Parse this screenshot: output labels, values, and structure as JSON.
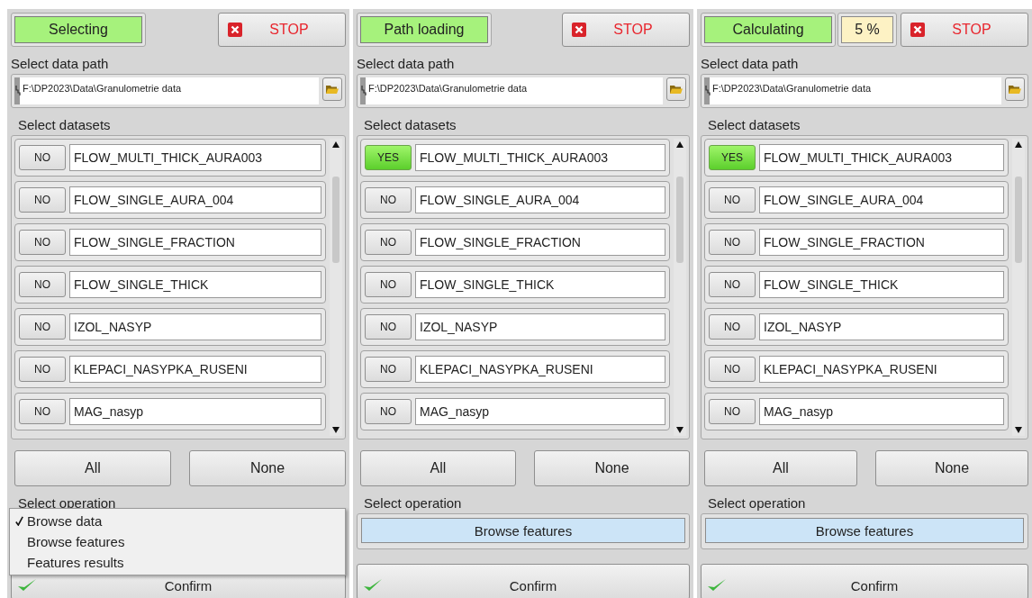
{
  "panels": [
    {
      "status": "Selecting",
      "stop": "STOP",
      "path_label": "Select data path",
      "path": "F:\\DP2023\\Data\\Granulometrie data",
      "datasets_label": "Select datasets",
      "datasets": [
        {
          "toggle": "NO",
          "selected": false,
          "name": "FLOW_MULTI_THICK_AURA003"
        },
        {
          "toggle": "NO",
          "selected": false,
          "name": "FLOW_SINGLE_AURA_004"
        },
        {
          "toggle": "NO",
          "selected": false,
          "name": "FLOW_SINGLE_FRACTION"
        },
        {
          "toggle": "NO",
          "selected": false,
          "name": "FLOW_SINGLE_THICK"
        },
        {
          "toggle": "NO",
          "selected": false,
          "name": "IZOL_NASYP"
        },
        {
          "toggle": "NO",
          "selected": false,
          "name": "KLEPACI_NASYPKA_RUSENI"
        },
        {
          "toggle": "NO",
          "selected": false,
          "name": "MAG_nasyp"
        }
      ],
      "all": "All",
      "none": "None",
      "operation_label": "Select operation",
      "operation_menu": [
        {
          "label": "Browse data",
          "selected": true
        },
        {
          "label": "Browse features",
          "selected": false
        },
        {
          "label": "Features results",
          "selected": false
        }
      ],
      "confirm": "Confirm"
    },
    {
      "status": "Path loading",
      "stop": "STOP",
      "path_label": "Select data path",
      "path": "F:\\DP2023\\Data\\Granulometrie data",
      "datasets_label": "Select datasets",
      "datasets": [
        {
          "toggle": "YES",
          "selected": true,
          "name": "FLOW_MULTI_THICK_AURA003"
        },
        {
          "toggle": "NO",
          "selected": false,
          "name": "FLOW_SINGLE_AURA_004"
        },
        {
          "toggle": "NO",
          "selected": false,
          "name": "FLOW_SINGLE_FRACTION"
        },
        {
          "toggle": "NO",
          "selected": false,
          "name": "FLOW_SINGLE_THICK"
        },
        {
          "toggle": "NO",
          "selected": false,
          "name": "IZOL_NASYP"
        },
        {
          "toggle": "NO",
          "selected": false,
          "name": "KLEPACI_NASYPKA_RUSENI"
        },
        {
          "toggle": "NO",
          "selected": false,
          "name": "MAG_nasyp"
        }
      ],
      "all": "All",
      "none": "None",
      "operation_label": "Select operation",
      "operation": "Browse features",
      "confirm": "Confirm"
    },
    {
      "status": "Calculating",
      "progress": "5 %",
      "stop": "STOP",
      "path_label": "Select data path",
      "path": "F:\\DP2023\\Data\\Granulometrie data",
      "datasets_label": "Select datasets",
      "datasets": [
        {
          "toggle": "YES",
          "selected": true,
          "name": "FLOW_MULTI_THICK_AURA003"
        },
        {
          "toggle": "NO",
          "selected": false,
          "name": "FLOW_SINGLE_AURA_004"
        },
        {
          "toggle": "NO",
          "selected": false,
          "name": "FLOW_SINGLE_FRACTION"
        },
        {
          "toggle": "NO",
          "selected": false,
          "name": "FLOW_SINGLE_THICK"
        },
        {
          "toggle": "NO",
          "selected": false,
          "name": "IZOL_NASYP"
        },
        {
          "toggle": "NO",
          "selected": false,
          "name": "KLEPACI_NASYPKA_RUSENI"
        },
        {
          "toggle": "NO",
          "selected": false,
          "name": "MAG_nasyp"
        }
      ],
      "all": "All",
      "none": "None",
      "operation_label": "Select operation",
      "operation": "Browse features",
      "confirm": "Confirm"
    }
  ]
}
